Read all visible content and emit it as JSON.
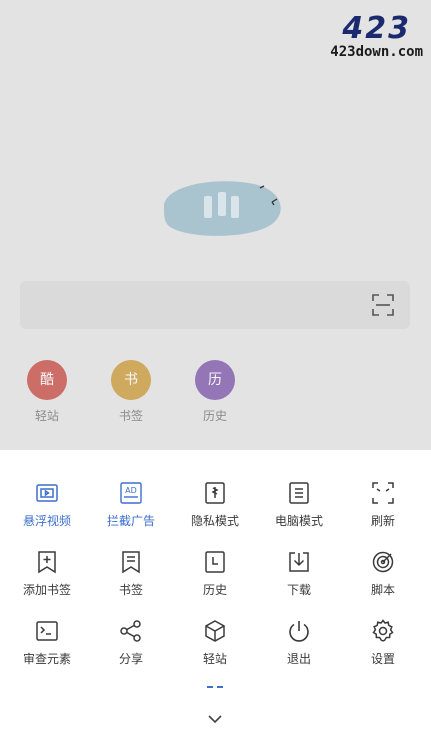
{
  "watermark": {
    "big": "423",
    "small": "423down.com"
  },
  "shortcuts": [
    {
      "glyph": "酷",
      "label": "轻站",
      "color": "#c6463f"
    },
    {
      "glyph": "书",
      "label": "书签",
      "color": "#c89632"
    },
    {
      "glyph": "历",
      "label": "历史",
      "color": "#7a52a8"
    }
  ],
  "menu": {
    "row1": [
      {
        "label": "悬浮视频",
        "icon": "floating-video-icon",
        "active": true
      },
      {
        "label": "拦截广告",
        "icon": "ad-block-icon",
        "active": true
      },
      {
        "label": "隐私模式",
        "icon": "privacy-mode-icon"
      },
      {
        "label": "电脑模式",
        "icon": "desktop-mode-icon"
      },
      {
        "label": "刷新",
        "icon": "refresh-icon"
      }
    ],
    "row2": [
      {
        "label": "添加书签",
        "icon": "add-bookmark-icon"
      },
      {
        "label": "书签",
        "icon": "bookmark-icon"
      },
      {
        "label": "历史",
        "icon": "history-icon"
      },
      {
        "label": "下载",
        "icon": "download-icon"
      },
      {
        "label": "脚本",
        "icon": "script-icon"
      }
    ],
    "row3": [
      {
        "label": "审查元素",
        "icon": "inspect-element-icon"
      },
      {
        "label": "分享",
        "icon": "share-icon"
      },
      {
        "label": "轻站",
        "icon": "light-site-icon"
      },
      {
        "label": "退出",
        "icon": "exit-icon"
      },
      {
        "label": "设置",
        "icon": "settings-icon"
      }
    ]
  },
  "colors": {
    "accent": "#3d6fcc",
    "icon": "#3a3a3a"
  }
}
